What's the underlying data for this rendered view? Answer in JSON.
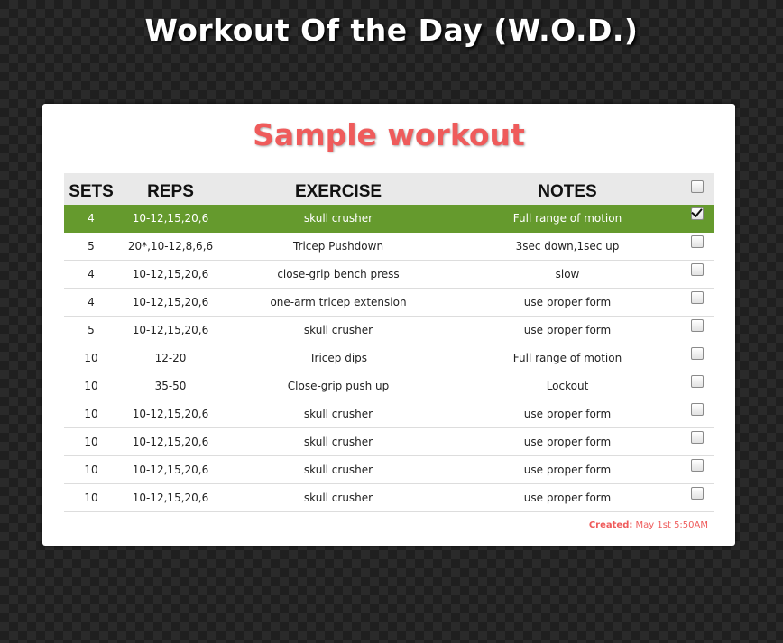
{
  "page": {
    "title": "Workout Of the Day (W.O.D.)"
  },
  "card": {
    "title": "Sample workout"
  },
  "table": {
    "headers": {
      "sets": "SETS",
      "reps": "REPS",
      "exercise": "EXERCISE",
      "notes": "NOTES"
    },
    "select_all_checked": false,
    "rows": [
      {
        "sets": "4",
        "reps": "10-12,15,20,6",
        "exercise": "skull crusher",
        "notes": "Full range of motion",
        "checked": true
      },
      {
        "sets": "5",
        "reps": "20*,10-12,8,6,6",
        "exercise": "Tricep Pushdown",
        "notes": "3sec down,1sec up",
        "checked": false
      },
      {
        "sets": "4",
        "reps": "10-12,15,20,6",
        "exercise": "close-grip bench press",
        "notes": "slow",
        "checked": false
      },
      {
        "sets": "4",
        "reps": "10-12,15,20,6",
        "exercise": "one-arm tricep extension",
        "notes": "use proper form",
        "checked": false
      },
      {
        "sets": "5",
        "reps": "10-12,15,20,6",
        "exercise": "skull crusher",
        "notes": "use proper form",
        "checked": false
      },
      {
        "sets": "10",
        "reps": "12-20",
        "exercise": "Tricep dips",
        "notes": "Full range of motion",
        "checked": false
      },
      {
        "sets": "10",
        "reps": "35-50",
        "exercise": "Close-grip push up",
        "notes": "Lockout",
        "checked": false
      },
      {
        "sets": "10",
        "reps": "10-12,15,20,6",
        "exercise": "skull crusher",
        "notes": "use proper form",
        "checked": false
      },
      {
        "sets": "10",
        "reps": "10-12,15,20,6",
        "exercise": "skull crusher",
        "notes": "use proper form",
        "checked": false
      },
      {
        "sets": "10",
        "reps": "10-12,15,20,6",
        "exercise": "skull crusher",
        "notes": "use proper form",
        "checked": false
      },
      {
        "sets": "10",
        "reps": "10-12,15,20,6",
        "exercise": "skull crusher",
        "notes": "use proper form",
        "checked": false
      }
    ]
  },
  "footer": {
    "created_label": "Created:",
    "created_value": "May 1st 5:50AM"
  },
  "colors": {
    "accent": "#ef5b5b",
    "done_row": "#659a2d",
    "header_bg": "#e9e9e9"
  }
}
